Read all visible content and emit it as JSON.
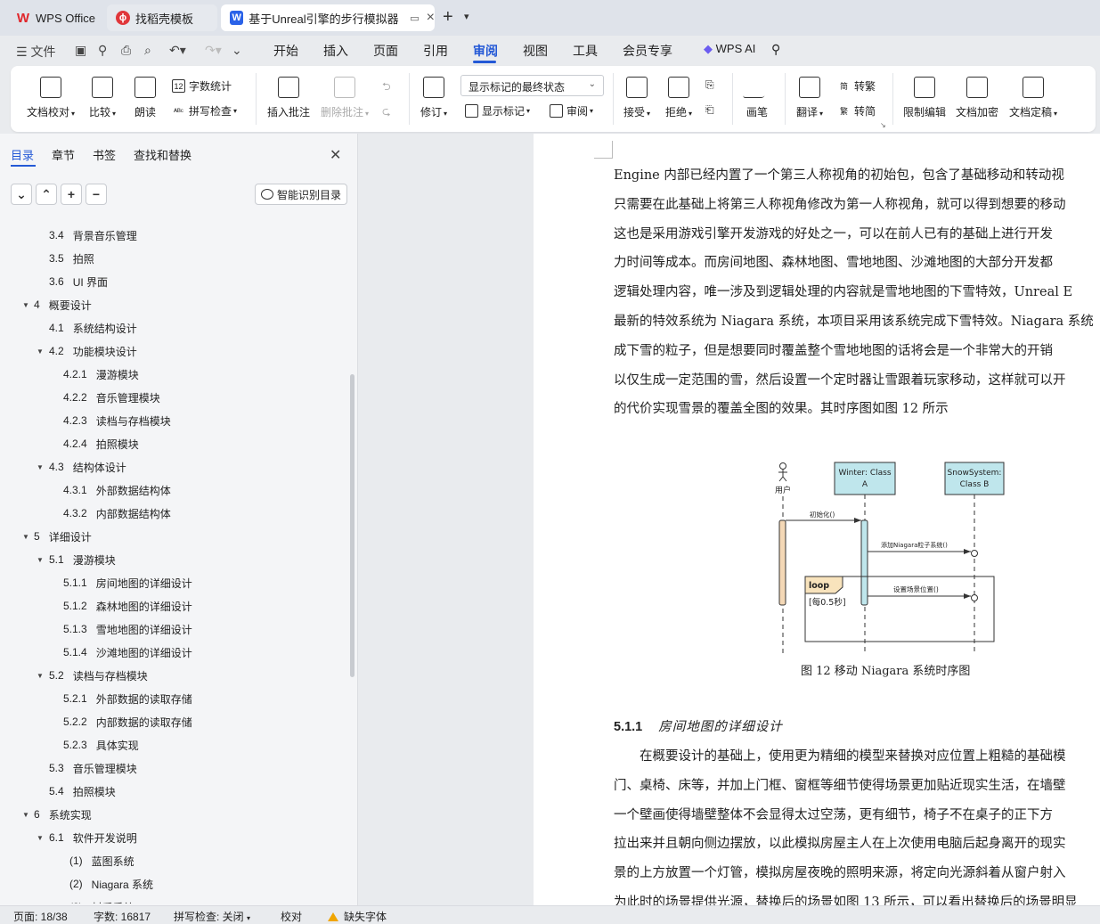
{
  "tabs": {
    "wps_office": "WPS Office",
    "template": "找稻壳模板",
    "document": "基于Unreal引擎的步行模拟器"
  },
  "menu": {
    "file": "文件",
    "items": [
      "开始",
      "插入",
      "页面",
      "引用",
      "审阅",
      "视图",
      "工具",
      "会员专享"
    ],
    "active": "审阅",
    "wps_ai": "WPS AI"
  },
  "ribbon": {
    "doc_check": "文档校对",
    "compare": "比较",
    "read_aloud": "朗读",
    "word_count": "字数统计",
    "spell_check": "拼写检查",
    "insert_comment": "插入批注",
    "delete_comment": "删除批注",
    "track_changes": "修订",
    "display_mode": "显示标记的最终状态",
    "show_markup": "显示标记",
    "review": "审阅",
    "accept": "接受",
    "reject": "拒绝",
    "pen": "画笔",
    "translate": "翻译",
    "to_traditional": "转繁",
    "to_simplified": "转简",
    "restrict_edit": "限制编辑",
    "encrypt": "文档加密",
    "finalize": "文档定稿"
  },
  "nav": {
    "tabs": [
      "目录",
      "章节",
      "书签",
      "查找和替换"
    ],
    "active_tab": "目录",
    "smart_toc": "智能识别目录",
    "toc": [
      {
        "level": 2,
        "num": "3.4",
        "text": "背景音乐管理",
        "expand": ""
      },
      {
        "level": 2,
        "num": "3.5",
        "text": "拍照",
        "expand": ""
      },
      {
        "level": 2,
        "num": "3.6",
        "text": "UI 界面",
        "expand": ""
      },
      {
        "level": 1,
        "num": "4",
        "text": "概要设计",
        "expand": "▼"
      },
      {
        "level": 2,
        "num": "4.1",
        "text": "系统结构设计",
        "expand": ""
      },
      {
        "level": 2,
        "num": "4.2",
        "text": "功能模块设计",
        "expand": "▼"
      },
      {
        "level": 3,
        "num": "4.2.1",
        "text": "漫游模块",
        "expand": ""
      },
      {
        "level": 3,
        "num": "4.2.2",
        "text": "音乐管理模块",
        "expand": ""
      },
      {
        "level": 3,
        "num": "4.2.3",
        "text": "读档与存档模块",
        "expand": ""
      },
      {
        "level": 3,
        "num": "4.2.4",
        "text": "拍照模块",
        "expand": ""
      },
      {
        "level": 2,
        "num": "4.3",
        "text": "结构体设计",
        "expand": "▼"
      },
      {
        "level": 3,
        "num": "4.3.1",
        "text": "外部数据结构体",
        "expand": ""
      },
      {
        "level": 3,
        "num": "4.3.2",
        "text": "内部数据结构体",
        "expand": ""
      },
      {
        "level": 1,
        "num": "5",
        "text": "详细设计",
        "expand": "▼"
      },
      {
        "level": 2,
        "num": "5.1",
        "text": "漫游模块",
        "expand": "▼"
      },
      {
        "level": 3,
        "num": "5.1.1",
        "text": "房间地图的详细设计",
        "expand": ""
      },
      {
        "level": 3,
        "num": "5.1.2",
        "text": "森林地图的详细设计",
        "expand": ""
      },
      {
        "level": 3,
        "num": "5.1.3",
        "text": "雪地地图的详细设计",
        "expand": ""
      },
      {
        "level": 3,
        "num": "5.1.4",
        "text": "沙滩地图的详细设计",
        "expand": ""
      },
      {
        "level": 2,
        "num": "5.2",
        "text": "读档与存档模块",
        "expand": "▼"
      },
      {
        "level": 3,
        "num": "5.2.1",
        "text": "外部数据的读取存储",
        "expand": ""
      },
      {
        "level": 3,
        "num": "5.2.2",
        "text": "内部数据的读取存储",
        "expand": ""
      },
      {
        "level": 3,
        "num": "5.2.3",
        "text": "具体实现",
        "expand": ""
      },
      {
        "level": 2,
        "num": "5.3",
        "text": "音乐管理模块",
        "expand": ""
      },
      {
        "level": 2,
        "num": "5.4",
        "text": "拍照模块",
        "expand": ""
      },
      {
        "level": 1,
        "num": "6",
        "text": "系统实现",
        "expand": "▼"
      },
      {
        "level": 2,
        "num": "6.1",
        "text": "软件开发说明",
        "expand": "▼"
      },
      {
        "level": 4,
        "num": "(1)",
        "text": "蓝图系统",
        "expand": ""
      },
      {
        "level": 4,
        "num": "(2)",
        "text": "Niagara 系统",
        "expand": ""
      },
      {
        "level": 4,
        "num": "(3)",
        "text": "材质系统",
        "expand": ""
      }
    ]
  },
  "document": {
    "paragraph1": [
      "Engine 内部已经内置了一个第三人称视角的初始包，包含了基础移动和转动视",
      "只需要在此基础上将第三人称视角修改为第一人称视角，就可以得到想要的移动",
      "这也是采用游戏引擎开发游戏的好处之一，可以在前人已有的基础上进行开发",
      "力时间等成本。而房间地图、森林地图、雪地地图、沙滩地图的大部分开发都",
      "逻辑处理内容，唯一涉及到逻辑处理的内容就是雪地地图的下雪特效，Unreal E",
      "最新的特效系统为 Niagara 系统，本项目采用该系统完成下雪特效。Niagara 系统",
      "成下雪的粒子，但是想要同时覆盖整个雪地地图的话将会是一个非常大的开销",
      "以仅生成一定范围的雪，然后设置一个定时器让雪跟着玩家移动，这样就可以开",
      "的代价实现雪景的覆盖全图的效果。其时序图如图 12 所示"
    ],
    "diagram": {
      "actor": "用户",
      "lifeline_a": [
        "Winter: Class",
        "A"
      ],
      "lifeline_b": [
        "SnowSystem:",
        "Class B"
      ],
      "msg_init": "初始化()",
      "msg_add": "添加Niagara粒子系统()",
      "msg_set": "设置场景位置()",
      "loop_label": "loop",
      "loop_guard": "[每0.5秒]"
    },
    "caption": "图 12  移动 Niagara 系统时序图",
    "heading_num": "5.1.1",
    "heading_text": "房间地图的详细设计",
    "paragraph2": [
      "　　在概要设计的基础上，使用更为精细的模型来替换对应位置上粗糙的基础模",
      "门、桌椅、床等，并加上门框、窗框等细节使得场景更加贴近现实生活，在墙壁",
      "一个壁画使得墙壁整体不会显得太过空荡，更有细节，椅子不在桌子的正下方",
      "拉出来并且朝向侧边摆放，以此模拟房屋主人在上次使用电脑后起身离开的现实",
      "景的上方放置一个灯管，模拟房屋夜晚的照明来源，将定向光源斜着从窗户射入",
      "为此时的场景提供光源，替换后的场景如图 13 所示，可以看出替换后的场景明显"
    ]
  },
  "status": {
    "page": "页面: 18/38",
    "words": "字数: 16817",
    "spell": "拼写检查: 关闭",
    "proof": "校对",
    "missing_font": "缺失字体"
  }
}
